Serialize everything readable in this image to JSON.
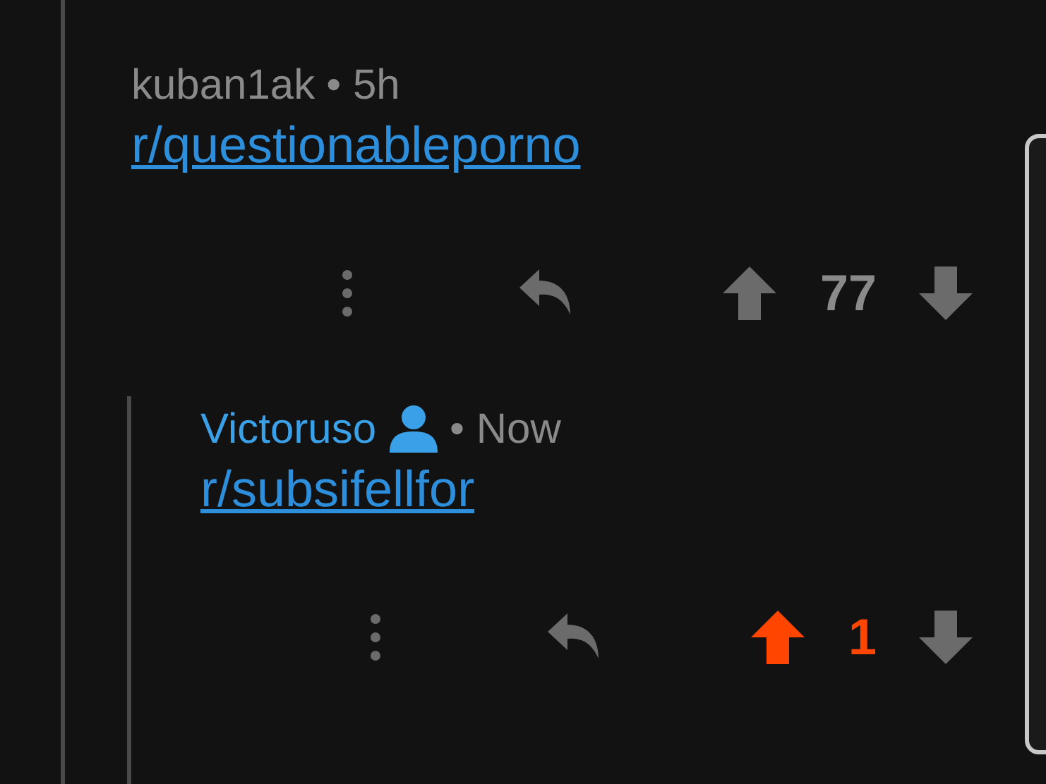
{
  "comments": [
    {
      "author": "kuban1ak",
      "author_highlight": false,
      "user_icon": false,
      "separator": "•",
      "time": "5h",
      "link": "r/questionableporno",
      "score": "77",
      "upvoted": false,
      "children": [
        {
          "author": "Victoruso",
          "author_highlight": true,
          "user_icon": true,
          "separator": "•",
          "time": "Now",
          "link": "r/subsifellfor",
          "score": "1",
          "upvoted": true
        }
      ]
    }
  ]
}
